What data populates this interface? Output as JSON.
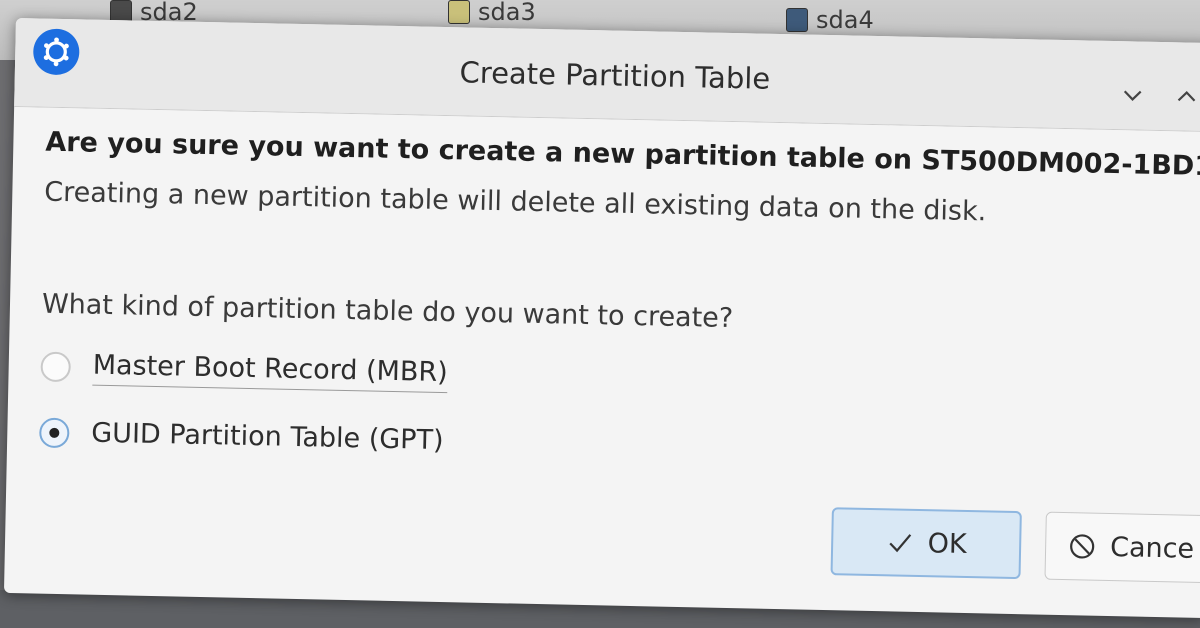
{
  "background": {
    "partitions": [
      "sda2",
      "sda3",
      "sda4"
    ],
    "colors": {
      "sda2": "#4a4a4a",
      "sda3": "#c9c07a",
      "sda4": "#3e5a7a"
    }
  },
  "dialog": {
    "title": "Create Partition Table",
    "app_icon": "kde-partition-manager-icon",
    "heading": "Are you sure you want to create a new partition table on ST500DM002-1BD1",
    "subtext": "Creating a new partition table will delete all existing data on the disk.",
    "question": "What kind of partition table do you want to create?",
    "options": [
      {
        "label": "Master Boot Record (MBR)",
        "selected": false
      },
      {
        "label": "GUID Partition Table (GPT)",
        "selected": true
      }
    ],
    "buttons": {
      "ok_label": "OK",
      "cancel_label": "Cance"
    },
    "accent_color": "#1d6ee0"
  }
}
